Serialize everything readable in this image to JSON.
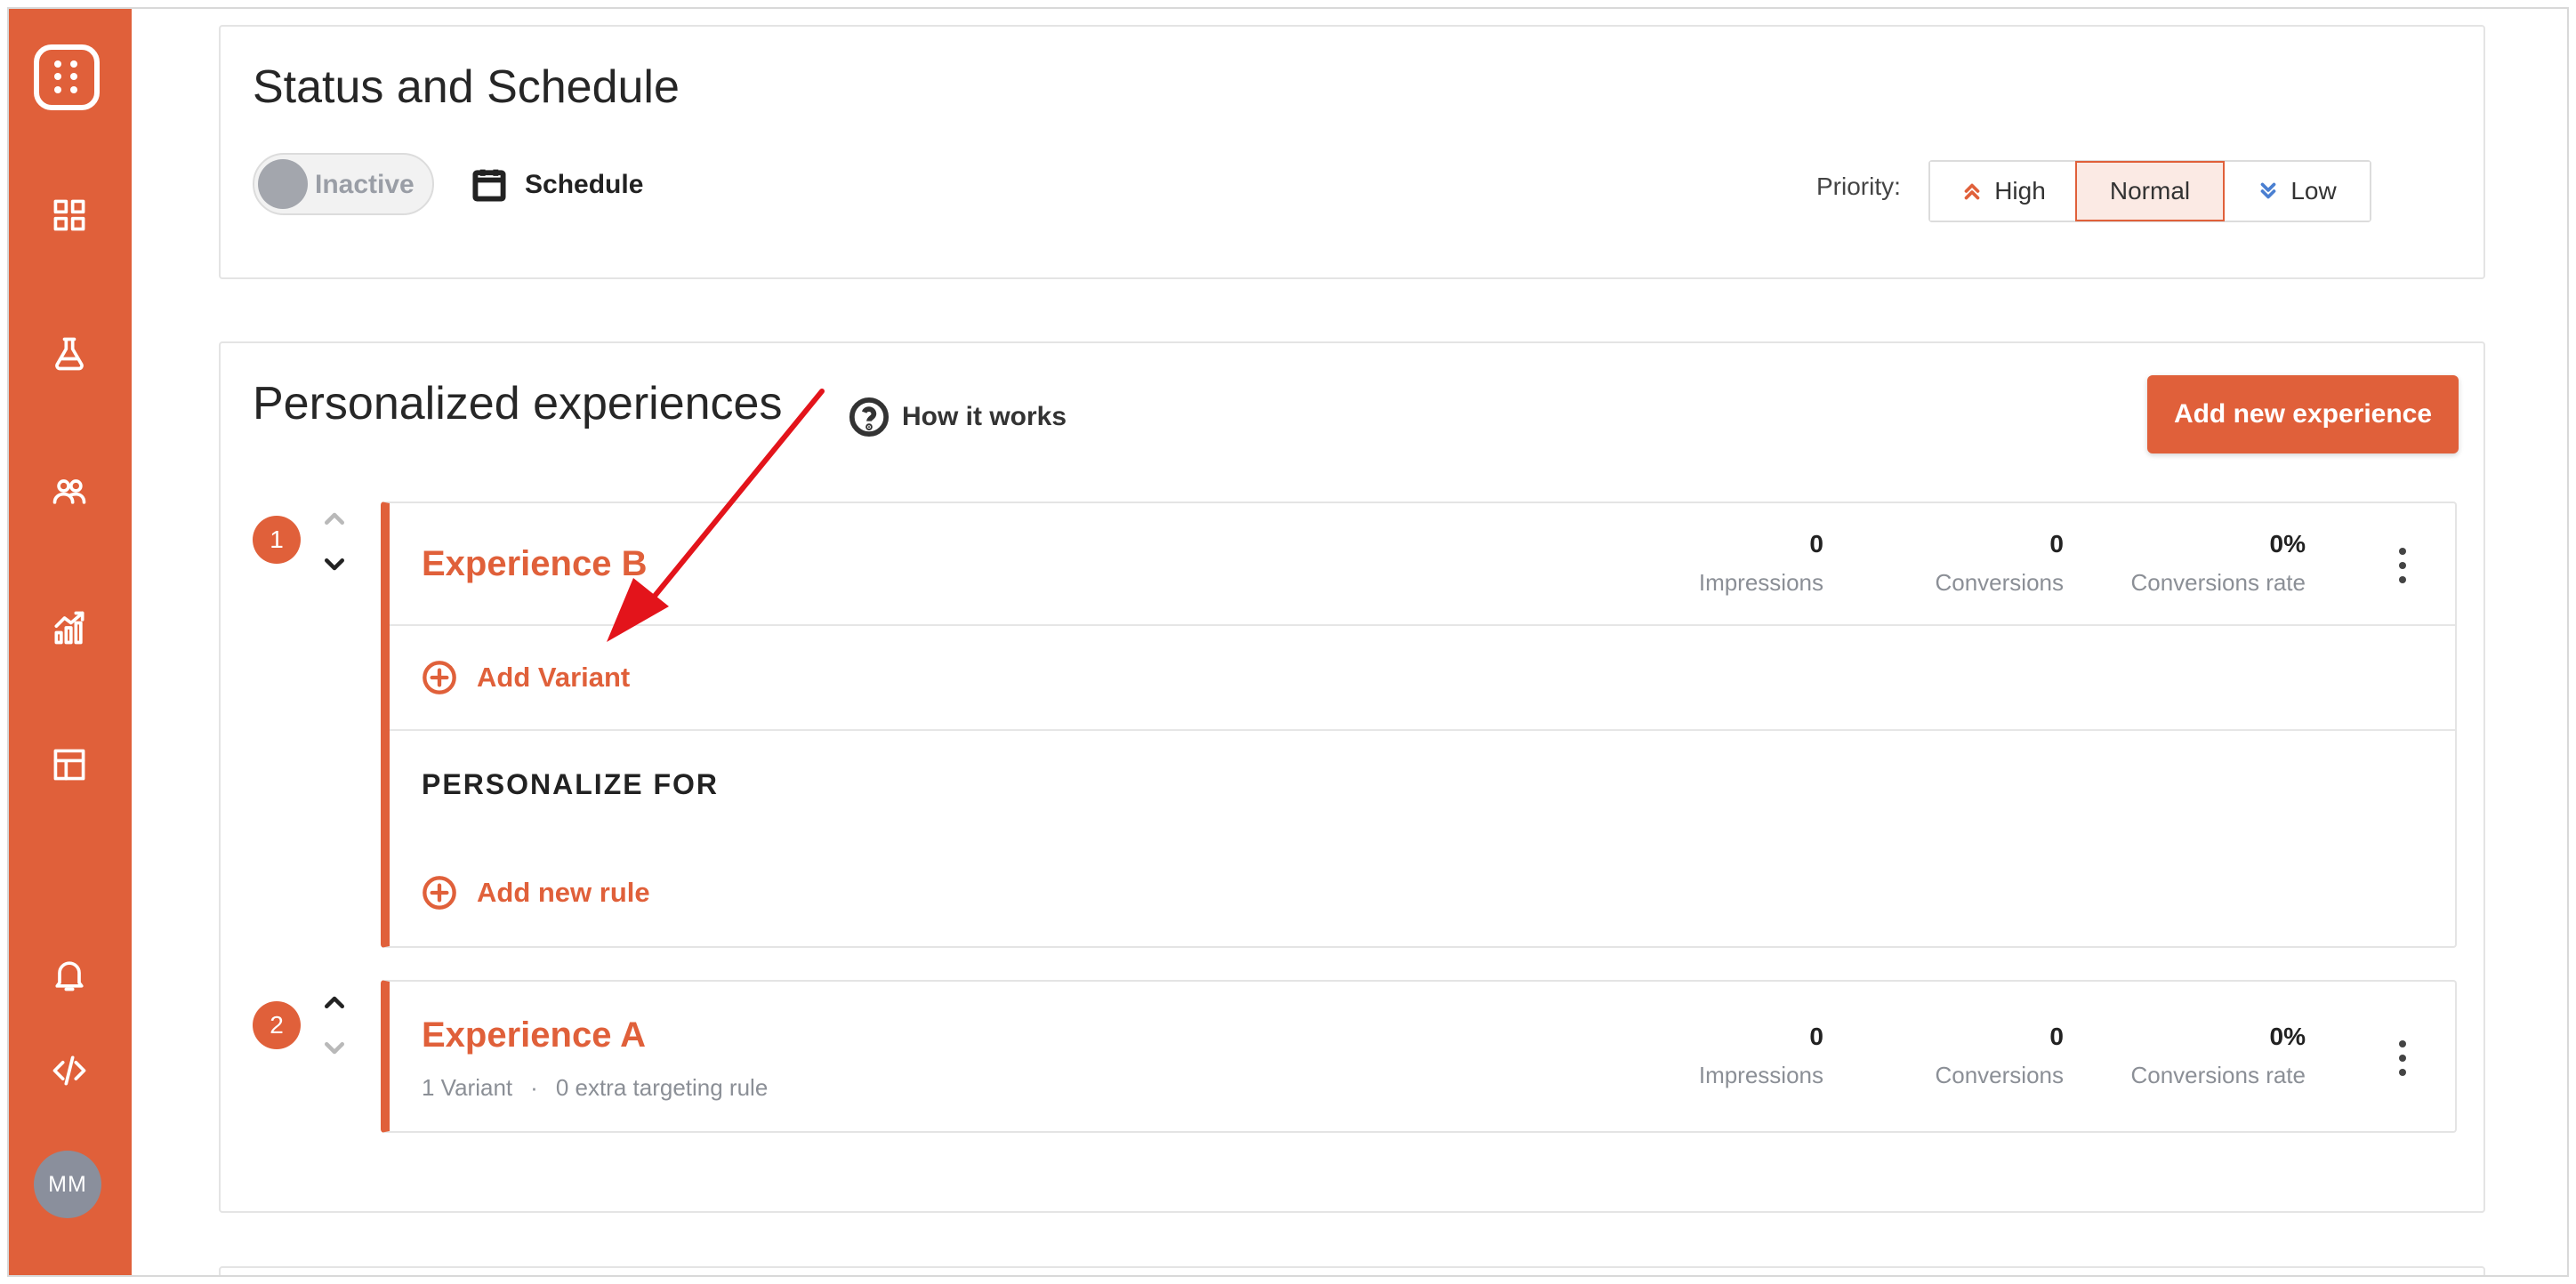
{
  "sidebar": {
    "avatar_initials": "MM",
    "icons": [
      "dashboard-icon",
      "experiments-icon",
      "audiences-icon",
      "analytics-icon",
      "layout-icon",
      "notifications-icon",
      "code-icon"
    ]
  },
  "status_section": {
    "title": "Status and Schedule",
    "toggle_label": "Inactive",
    "schedule_label": "Schedule",
    "priority_label": "Priority:",
    "priority_options": [
      "High",
      "Normal",
      "Low"
    ],
    "priority_selected": "Normal"
  },
  "personalized_section": {
    "title": "Personalized experiences",
    "how_it_works": "How it works",
    "add_button": "Add new experience",
    "experiences": [
      {
        "rank": "1",
        "name": "Experience B",
        "impressions": "0",
        "conversions": "0",
        "conversion_rate": "0%",
        "add_variant": "Add Variant",
        "personalize_for": "PERSONALIZE FOR",
        "add_rule": "Add new rule"
      },
      {
        "rank": "2",
        "name": "Experience A",
        "impressions": "0",
        "conversions": "0",
        "conversion_rate": "0%",
        "variants": "1 Variant",
        "separator": "·",
        "targeting": "0 extra targeting rule"
      }
    ],
    "stat_labels": {
      "impressions": "Impressions",
      "conversions": "Conversions",
      "conversion_rate": "Conversions rate"
    }
  },
  "colors": {
    "brand": "#e0603a",
    "priority_low": "#4a7fd1"
  }
}
